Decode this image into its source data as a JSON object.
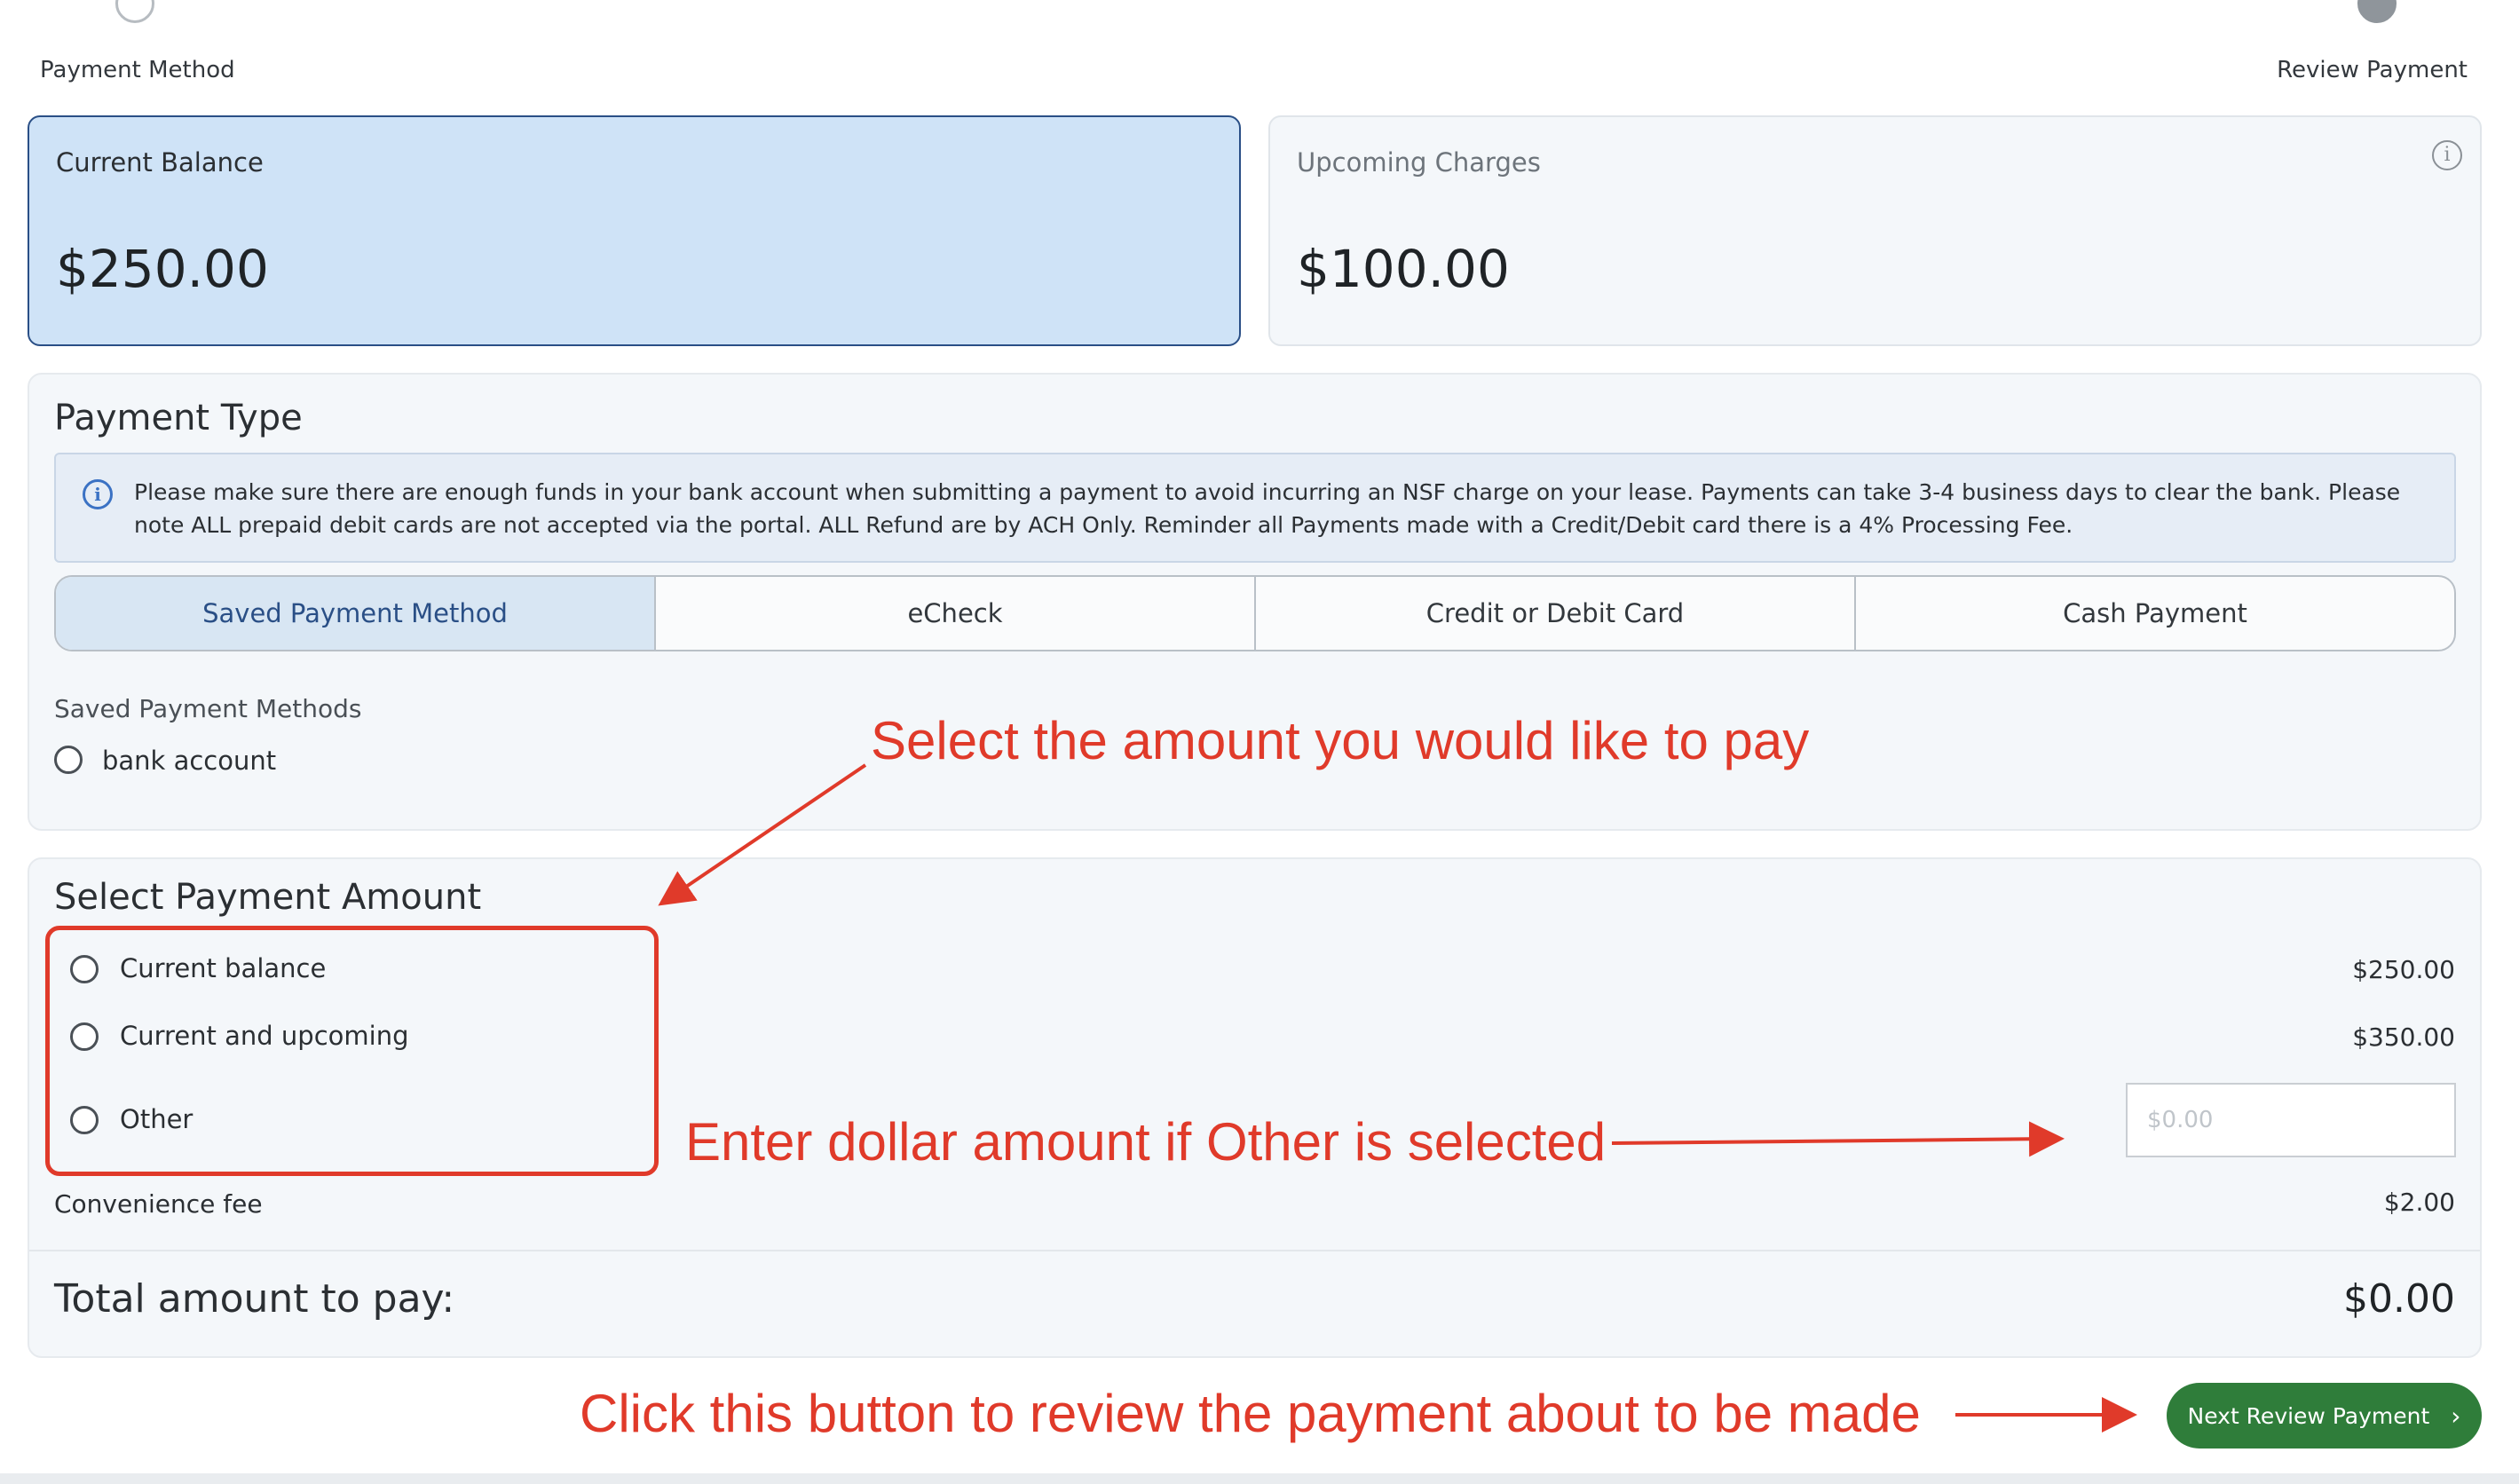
{
  "stepper": {
    "left_label": "Payment Method",
    "right_label": "Review Payment"
  },
  "balances": {
    "current_title": "Current Balance",
    "current_amount": "$250.00",
    "upcoming_title": "Upcoming Charges",
    "upcoming_amount": "$100.00",
    "info_icon": "i"
  },
  "payment_type": {
    "heading": "Payment Type",
    "notice_icon": "i",
    "notice": "Please make sure there are enough funds in your bank account when submitting a payment to avoid incurring an NSF charge on your lease. Payments can take 3-4 business days to clear the bank. Please note ALL prepaid debit cards are not accepted via the portal. ALL Refund are by ACH Only. Reminder all Payments made with a Credit/Debit card there is a 4% Processing Fee.",
    "tabs": [
      "Saved Payment Method",
      "eCheck",
      "Credit or Debit Card",
      "Cash Payment"
    ],
    "saved_label": "Saved Payment Methods",
    "saved_options": [
      "bank account"
    ]
  },
  "payment_amount": {
    "heading": "Select Payment Amount",
    "options": [
      {
        "label": "Current balance",
        "amount": "$250.00"
      },
      {
        "label": "Current and upcoming",
        "amount": "$350.00"
      },
      {
        "label": "Other",
        "placeholder": "$0.00"
      }
    ],
    "fee_label": "Convenience fee",
    "fee_amount": "$2.00",
    "total_label": "Total amount to pay:",
    "total_amount": "$0.00"
  },
  "next_button": {
    "label": "Next Review Payment",
    "chevron": "›"
  },
  "annotations": {
    "select_amount": "Select the amount you would like to pay",
    "enter_other": "Enter dollar amount if Other is selected",
    "click_button": "Click this button to review  the payment about to be made",
    "color": "#e03a2a"
  },
  "icons": [
    "info-icon",
    "chevron-right-icon",
    "radio-icon"
  ]
}
